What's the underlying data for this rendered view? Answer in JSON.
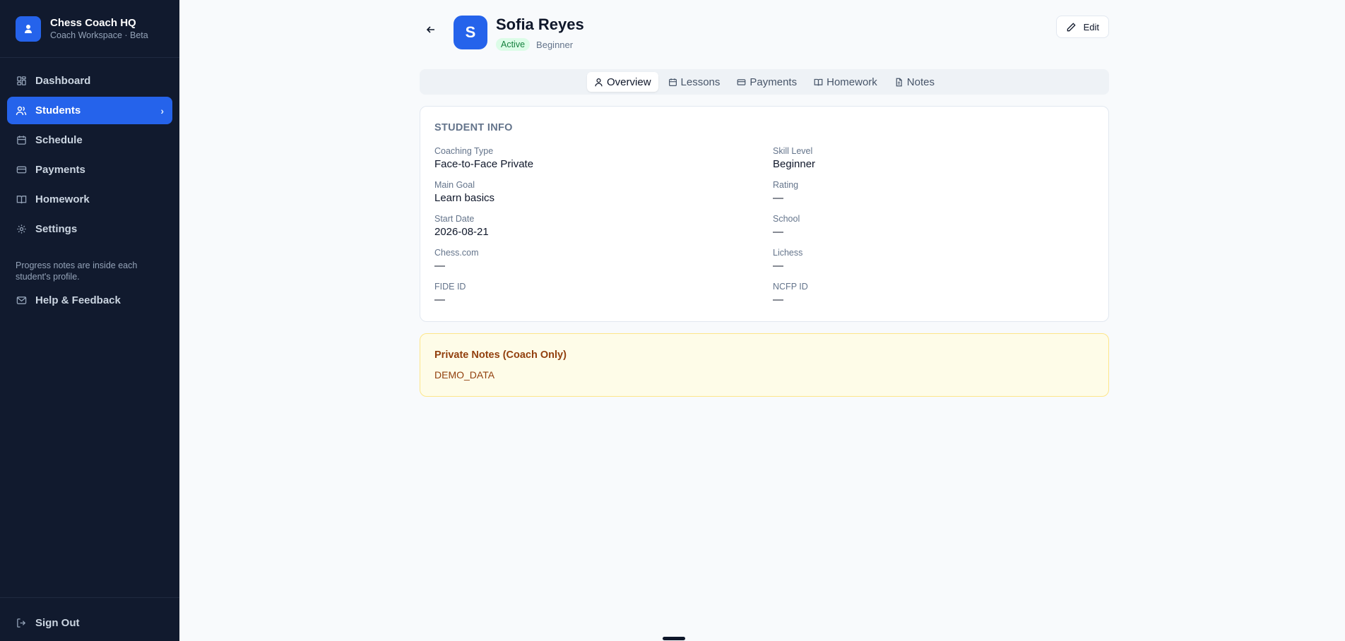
{
  "brand": {
    "title": "Chess Coach HQ",
    "subtitle": "Coach Workspace · Beta",
    "icon": "user-icon"
  },
  "sidebar": {
    "items": [
      {
        "label": "Dashboard",
        "icon": "grid-icon"
      },
      {
        "label": "Students",
        "icon": "users-icon",
        "active": true
      },
      {
        "label": "Schedule",
        "icon": "calendar-icon"
      },
      {
        "label": "Payments",
        "icon": "credit-card-icon"
      },
      {
        "label": "Homework",
        "icon": "book-icon"
      },
      {
        "label": "Settings",
        "icon": "gear-icon"
      }
    ],
    "note": "Progress notes are inside each student's profile.",
    "help_label": "Help & Feedback",
    "signout_label": "Sign Out"
  },
  "student": {
    "initial": "S",
    "name": "Sofia Reyes",
    "status": "Active",
    "level": "Beginner"
  },
  "header": {
    "edit_label": "Edit"
  },
  "tabs": [
    {
      "label": "Overview",
      "icon": "user-icon",
      "active": true
    },
    {
      "label": "Lessons",
      "icon": "calendar-icon"
    },
    {
      "label": "Payments",
      "icon": "credit-card-icon"
    },
    {
      "label": "Homework",
      "icon": "book-icon"
    },
    {
      "label": "Notes",
      "icon": "file-icon"
    }
  ],
  "info": {
    "title": "STUDENT INFO",
    "fields": [
      {
        "label": "Coaching Type",
        "value": "Face-to-Face Private"
      },
      {
        "label": "Skill Level",
        "value": "Beginner"
      },
      {
        "label": "Main Goal",
        "value": "Learn basics"
      },
      {
        "label": "Rating",
        "value": "—"
      },
      {
        "label": "Start Date",
        "value": "2026-08-21"
      },
      {
        "label": "School",
        "value": "—"
      },
      {
        "label": "Chess.com",
        "value": "—"
      },
      {
        "label": "Lichess",
        "value": "—"
      },
      {
        "label": "FIDE ID",
        "value": "—"
      },
      {
        "label": "NCFP ID",
        "value": "—"
      }
    ]
  },
  "private_notes": {
    "title": "Private Notes (Coach Only)",
    "body": "DEMO_DATA"
  },
  "colors": {
    "accent": "#2563eb",
    "sidebar_bg": "#111a2e",
    "notes_bg": "#fefce8",
    "notes_text": "#92400e",
    "active_badge": "#15803d"
  }
}
